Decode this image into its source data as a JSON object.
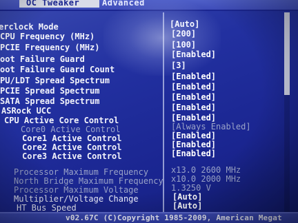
{
  "tabs": {
    "active": "OC Tweaker",
    "next": "Advanced"
  },
  "settings": [
    {
      "label": "erclock Mode",
      "value": "[Auto]"
    },
    {
      "label": "CPU Frequency (MHz)",
      "value": "[200]"
    },
    {
      "label": "PCIE Frequency (MHz)",
      "value": "[100]"
    },
    {
      "label": "oot Failure Guard",
      "value": "[Enabled]"
    },
    {
      "label": "oot Failure Guard Count",
      "value": "[3]"
    },
    {
      "label": "PU/LDT Spread Spectrum",
      "value": "[Enabled]"
    },
    {
      "label": "PCIE Spread Spectrum",
      "value": "[Enabled]"
    },
    {
      "label": "SATA Spread Spectrum",
      "value": "[Enabled]"
    },
    {
      "label": "ASRock UCC",
      "value": "[Enabled]"
    },
    {
      "label": "CPU Active Core Control",
      "value": "[Enabled]"
    },
    {
      "label": "Core0 Active Control",
      "value": "[Always Enabled]"
    },
    {
      "label": "Core1 Active Control",
      "value": "[Enabled]"
    },
    {
      "label": "Core2 Active Control",
      "value": "[Enabled]"
    },
    {
      "label": "Core3 Active Control",
      "value": "[Enabled]"
    }
  ],
  "info": [
    {
      "label": "Processor Maximum Frequency",
      "value": "x13.0 2600 MHz"
    },
    {
      "label": "North Bridge Maximum Frequency",
      "value": "x10.0 2000 MHz"
    },
    {
      "label": "Processor Maximum Voltage",
      "value": "1.3250 V"
    }
  ],
  "more_settings": [
    {
      "label": "Multiplier/Voltage Change",
      "value": "[Auto]"
    },
    {
      "label": "HT Bus Speed",
      "value": "[Auto]"
    }
  ],
  "footer": "v02.67C (C)Copyright 1985-2009, American Megat"
}
